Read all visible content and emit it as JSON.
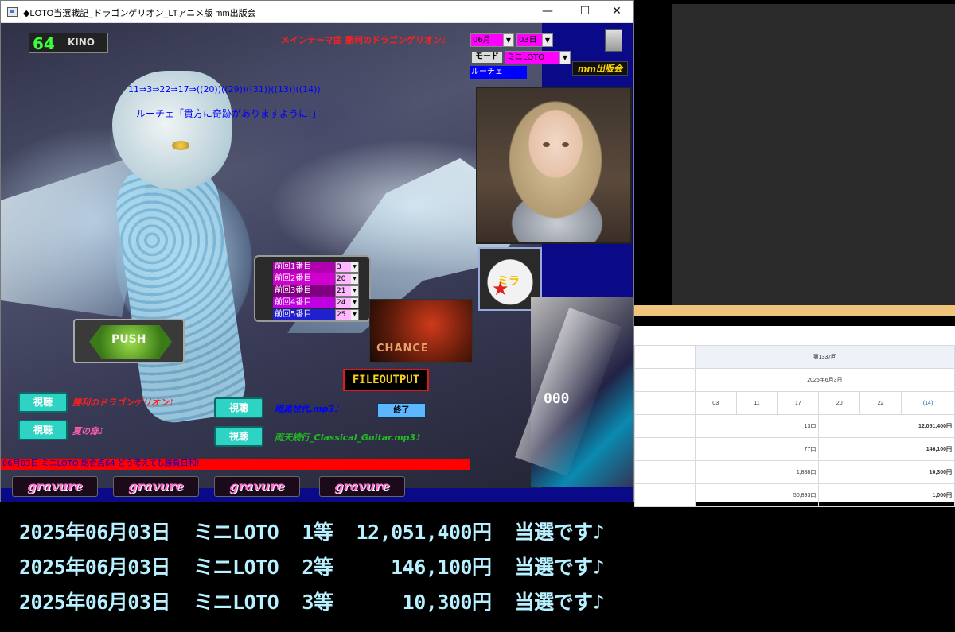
{
  "window": {
    "title": "◆LOTO当選戦記_ドラゴンゲリオン_LTアニメ版 mm出版会",
    "minimize": "—",
    "maximize": "☐",
    "close": "✕"
  },
  "header": {
    "theme_song": "メインテーマ曲 勝利のドラゴンゲリオン♪",
    "score_num": "64",
    "score_label": "KINO",
    "month": "06月",
    "day": "03日",
    "mode_label": "モード",
    "mode_value": "ミニLOTO",
    "luce_label": "ルーチェ",
    "publisher": "mm出版会"
  },
  "prediction": {
    "sequence": "11⇒3⇒22⇒17⇒((20))((29))((31))((13))((14))",
    "message": "ルーチェ「貴方に奇跡がありますように!」"
  },
  "previous": [
    {
      "label": "前回1番目",
      "value": "3"
    },
    {
      "label": "前回2番目",
      "value": "20"
    },
    {
      "label": "前回3番目",
      "value": "21"
    },
    {
      "label": "前回4番目",
      "value": "24"
    },
    {
      "label": "前回5番目",
      "value": "25"
    }
  ],
  "buttons": {
    "push": "PUSH",
    "fileoutput": "FILEOUTPUT",
    "end": "終了",
    "chance": "CHANCE",
    "play": "視聴",
    "gravure": "gravure"
  },
  "songs": [
    {
      "name": "勝利のドラゴンゲリオン♪",
      "color": "#ff2020"
    },
    {
      "name": "夏の扉♪",
      "color": "#ff5db0"
    },
    {
      "name": "暗黒世代.mp3♪",
      "color": "#0000ff"
    },
    {
      "name": "雨天続行_Classical_Guitar.mp3♪",
      "color": "#22bb22"
    }
  ],
  "status": "06月03日 ミニLOTO 総合点64 どう考えても勝負日和!",
  "results": {
    "round": "第1337回",
    "date": "2025年6月3日",
    "numbers": [
      "03",
      "11",
      "17",
      "20",
      "22",
      "(14)"
    ],
    "prizes": [
      {
        "count": "13口",
        "amount": "12,051,400円"
      },
      {
        "count": "77口",
        "amount": "146,100円"
      },
      {
        "count": "1,888口",
        "amount": "10,300円"
      },
      {
        "count": "50,893口",
        "amount": "1,000円"
      }
    ]
  },
  "banner": [
    "2025年06月03日  ミニLOTO  1等  12,051,400円  当選です♪",
    "2025年06月03日  ミニLOTO  2等     146,100円  当選です♪",
    "2025年06月03日  ミニLOTO  3等      10,300円  当選です♪"
  ]
}
